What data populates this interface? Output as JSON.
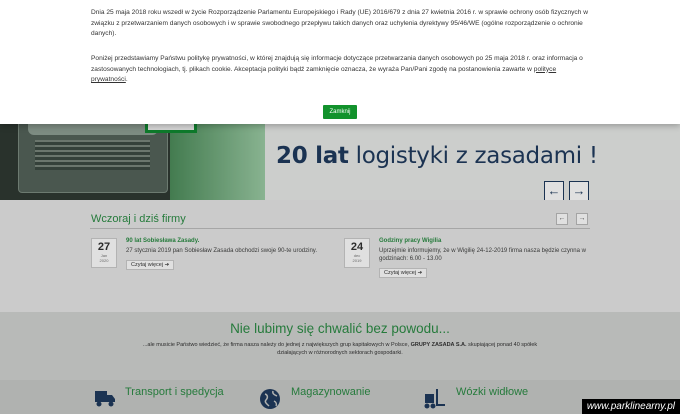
{
  "cookie": {
    "paragraph1": "Dnia 25 maja 2018 roku wszedł w życie Rozporządzenie Parlamentu Europejskiego i Rady (UE) 2016/679 z dnia 27 kwietnia 2016 r. w sprawie ochrony osób fizycznych w związku z przetwarzaniem danych osobowych i w sprawie swobodnego przepływu takich danych oraz uchylenia dyrektywy 95/46/WE (ogólne rozporządzenie o ochronie danych).",
    "paragraph2": "Poniżej przedstawiamy Państwu politykę prywatności, w której znajdują się informacje dotyczące przetwarzania danych osobowych po 25 maja 2018 r. oraz informacja o zastosowanych technologiach, tj. plikach cookie. Akceptacja polityki bądź zamknięcie oznacza, że wyraża Pan/Pani zgodę na postanowienia zawarte w",
    "link_label": "polityce prywatności",
    "link_suffix": ".",
    "close_label": "Zamknij"
  },
  "hero": {
    "slogan_bold": "20 lat",
    "slogan_rest": " logistyki z zasadami !",
    "prev_icon": "←",
    "next_icon": "→"
  },
  "news": {
    "heading": "Wczoraj i dziś firmy",
    "prev_icon": "←",
    "next_icon": "→",
    "items": [
      {
        "day": "27",
        "month": "Jan",
        "year": "2020",
        "title": "90 lat Sobiesława Zasady.",
        "text": "27 stycznia 2019 pan Sobiesław Zasada obchodzi swoje 90-te urodziny.",
        "more": "Czytaj więcej ➔"
      },
      {
        "day": "24",
        "month": "dec",
        "year": "2019",
        "title": "Godziny pracy Wigilia",
        "text": "Uprzejmie informujemy, że w Wigilię 24-12-2019 firma nasza będzie czynna w godzinach: 6.00 - 13.00",
        "more": "Czytaj więcej ➔"
      }
    ]
  },
  "about": {
    "heading": "Nie lubimy się chwalić bez powodu...",
    "text_before": "...ale musicie Państwo wiedzieć, że firma nasza należy do jednej z największych grup kapitałowych w Polsce,",
    "text_bold": "GRUPY ZASADA S.A.",
    "text_after": "skupiającej ponad 40 spółek działających w różnorodnych sektorach gospodarki."
  },
  "services": [
    {
      "label": "Transport i spedycja",
      "icon": "truck-icon"
    },
    {
      "label": "Magazynowanie",
      "icon": "globe-icon"
    },
    {
      "label": "Wózki widłowe",
      "icon": "forklift-icon"
    }
  ],
  "watermark": "www.parklinearny.pl",
  "colors": {
    "brand_green": "#12922c",
    "navy": "#1f3b5e"
  }
}
